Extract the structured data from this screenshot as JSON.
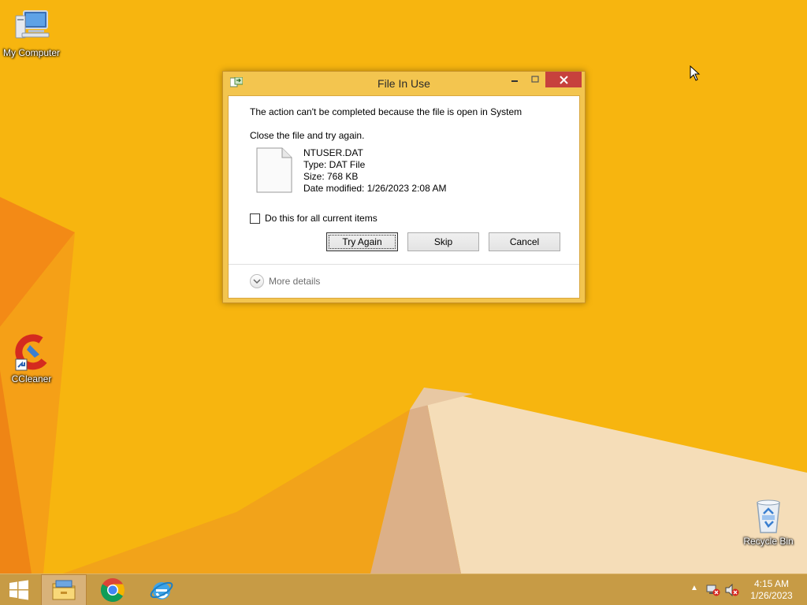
{
  "desktop": {
    "icons": [
      {
        "label": "My Computer"
      },
      {
        "label": "CCleaner"
      },
      {
        "label": "Recycle Bin"
      }
    ]
  },
  "dialog": {
    "title": "File In Use",
    "message": "The action can't be completed because the file is open in System",
    "instruction": "Close the file and try again.",
    "file": {
      "name": "NTUSER.DAT",
      "type": "Type: DAT File",
      "size": "Size: 768 KB",
      "modified": "Date modified: 1/26/2023 2:08 AM"
    },
    "checkbox_label": "Do this for all current items",
    "checkbox_checked": false,
    "buttons": {
      "try_again": "Try Again",
      "skip": "Skip",
      "cancel": "Cancel"
    },
    "more_details": "More details",
    "window_controls": {
      "minimize": "minimize-icon",
      "maximize": "maximize-icon",
      "close": "close-icon"
    }
  },
  "taskbar": {
    "start": "windows-logo-icon",
    "pinned": [
      "file-explorer-icon",
      "chrome-icon",
      "internet-explorer-icon"
    ],
    "tray_icons": [
      "show-hidden-icons-icon",
      "network-icon",
      "volume-muted-icon"
    ],
    "clock": {
      "time": "4:15 AM",
      "date": "1/26/2023"
    }
  },
  "colors": {
    "wallpaper": "#f7b50f",
    "dialog_frame": "#f3c54f",
    "close_button": "#c7413d",
    "taskbar": "#c79b45"
  }
}
